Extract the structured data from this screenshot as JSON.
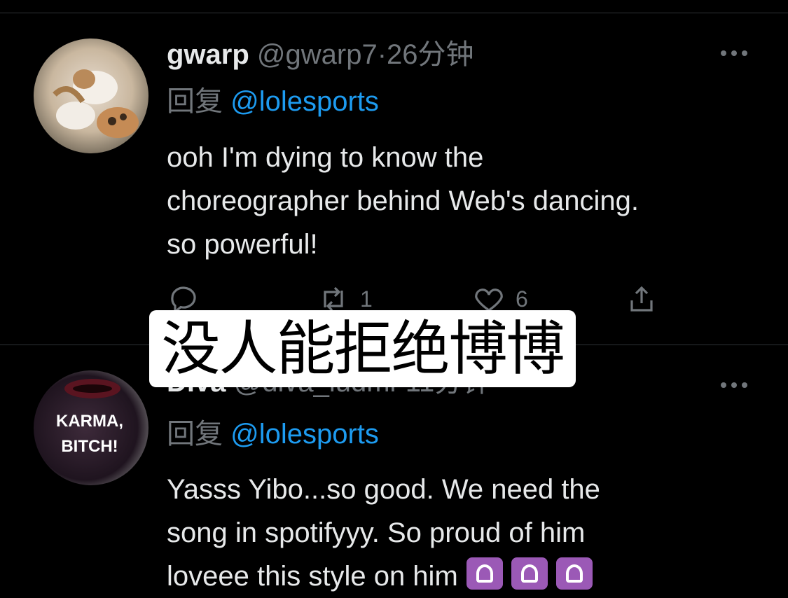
{
  "tweets": [
    {
      "name": "gwarp",
      "handle": "@gwarp7",
      "separator": "·",
      "time": "26分钟",
      "reply_prefix": "回复",
      "reply_to": "@lolesports",
      "text_lines": [
        "ooh I'm dying to know the",
        "choreographer behind Web's dancing.",
        "so powerful!"
      ],
      "actions": {
        "reply_count": "",
        "retweet_count": "1",
        "like_count": "6"
      },
      "avatar_icon": "dog-avatar"
    },
    {
      "name": "Diva",
      "handle": "@diva_ludmi",
      "separator": "·",
      "time": "11分钟",
      "reply_prefix": "回复",
      "reply_to": "@lolesports",
      "text_lines": [
        "Yasss Yibo...so good. We need the",
        "song in spotifyyy. So proud of him",
        "loveee this style on him"
      ],
      "avatar_icon": "karma-avatar",
      "avatar_text": [
        "KARMA,",
        "BITCH!"
      ],
      "emoji_names": [
        "purple-dancing-emoji",
        "purple-dancing-emoji",
        "purple-dancing-emoji"
      ]
    }
  ],
  "overlay_caption": "没人能拒绝博博",
  "colors": {
    "background": "#000000",
    "muted": "#71767b",
    "link": "#1d9bf0",
    "text": "#e7e9ea"
  }
}
